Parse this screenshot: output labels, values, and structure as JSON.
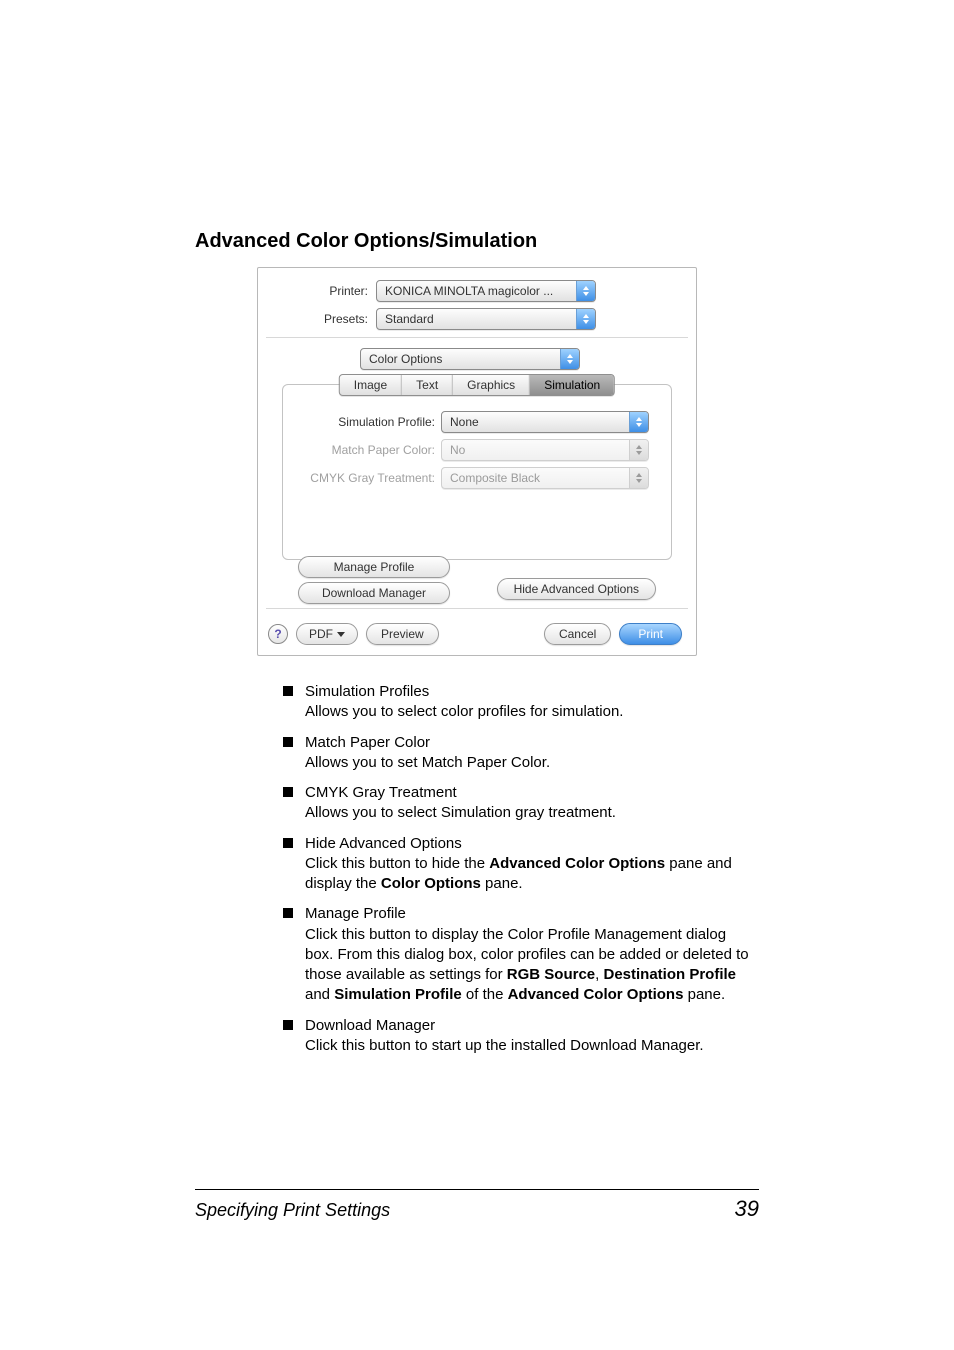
{
  "section_title": "Advanced Color Options/Simulation",
  "dialog": {
    "labels": {
      "printer": "Printer:",
      "presets": "Presets:"
    },
    "printer_value": "KONICA MINOLTA magicolor ...",
    "presets_value": "Standard",
    "pane_value": "Color Options",
    "tabs": {
      "image": "Image",
      "text": "Text",
      "graphics": "Graphics",
      "simulation": "Simulation"
    },
    "fields": {
      "sim_profile_label": "Simulation Profile:",
      "sim_profile_value": "None",
      "match_paper_label": "Match Paper Color:",
      "match_paper_value": "No",
      "cmyk_label": "CMYK Gray Treatment:",
      "cmyk_value": "Composite Black"
    },
    "buttons": {
      "manage_profile": "Manage Profile",
      "download_manager": "Download Manager",
      "hide_advanced": "Hide Advanced Options",
      "pdf": "PDF",
      "preview": "Preview",
      "cancel": "Cancel",
      "print": "Print",
      "help": "?"
    }
  },
  "bullets": [
    {
      "term": "Simulation Profiles",
      "desc": "Allows you to select color profiles for simulation."
    },
    {
      "term": "Match Paper Color",
      "desc": "Allows you to set Match Paper Color."
    },
    {
      "term": "CMYK Gray Treatment",
      "desc": "Allows you to select Simulation gray treatment."
    },
    {
      "term": "Hide Advanced Options",
      "desc_html": "Click this button to hide the <b>Advanced Color Options</b> pane and display the <b>Color Options</b> pane."
    },
    {
      "term": "Manage Profile",
      "desc_html": "Click this button to display the Color Profile Management dialog box. From this dialog box, color profiles can be added or deleted to those available as settings for <b>RGB Source</b>, <b>Destination Profile</b> and <b>Simulation Profile</b> of the <b>Advanced Color Options</b> pane."
    },
    {
      "term": "Download Manager",
      "desc": "Click this button to start up the installed Download Manager."
    }
  ],
  "footer": {
    "left": "Specifying Print Settings",
    "page_number": "39"
  }
}
